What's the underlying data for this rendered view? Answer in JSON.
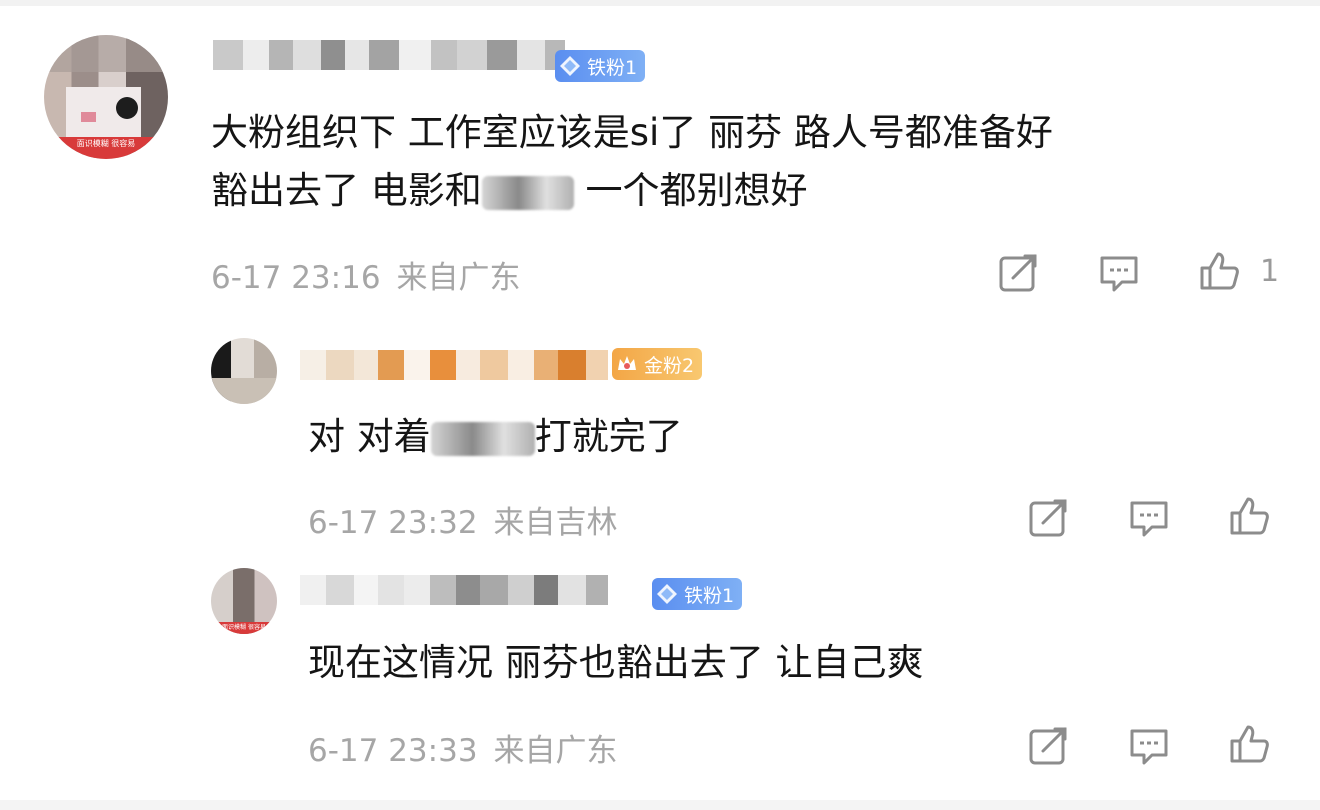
{
  "comments": [
    {
      "avatar_caption": "面识模糊 很容易",
      "badge": "铁粉1",
      "badge_type": "iron",
      "line1": "大粉组织下  工作室应该是si了  丽芬 路人号都准备好",
      "line2a": "豁出去了  电影和",
      "line2b": "  一个都别想好",
      "time": "6-17 23:16",
      "location": "来自广东",
      "like_count": "1"
    },
    {
      "badge": "金粉2",
      "badge_type": "gold",
      "line1a": "对 对着",
      "line1b": "打就完了",
      "time": "6-17 23:32",
      "location": "来自吉林",
      "like_count": ""
    },
    {
      "avatar_caption": "面识模糊 很容易",
      "badge": "铁粉1",
      "badge_type": "iron",
      "line1": "现在这情况  丽芬也豁出去了  让自己爽",
      "time": "6-17 23:33",
      "location": "来自广东",
      "like_count": ""
    }
  ],
  "icons": [
    "share-icon",
    "comment-icon",
    "like-icon"
  ],
  "colors": {
    "iron_badge": "#5a8ef0",
    "gold_badge": "#f3a646",
    "meta_gray": "#a6a6a6"
  }
}
